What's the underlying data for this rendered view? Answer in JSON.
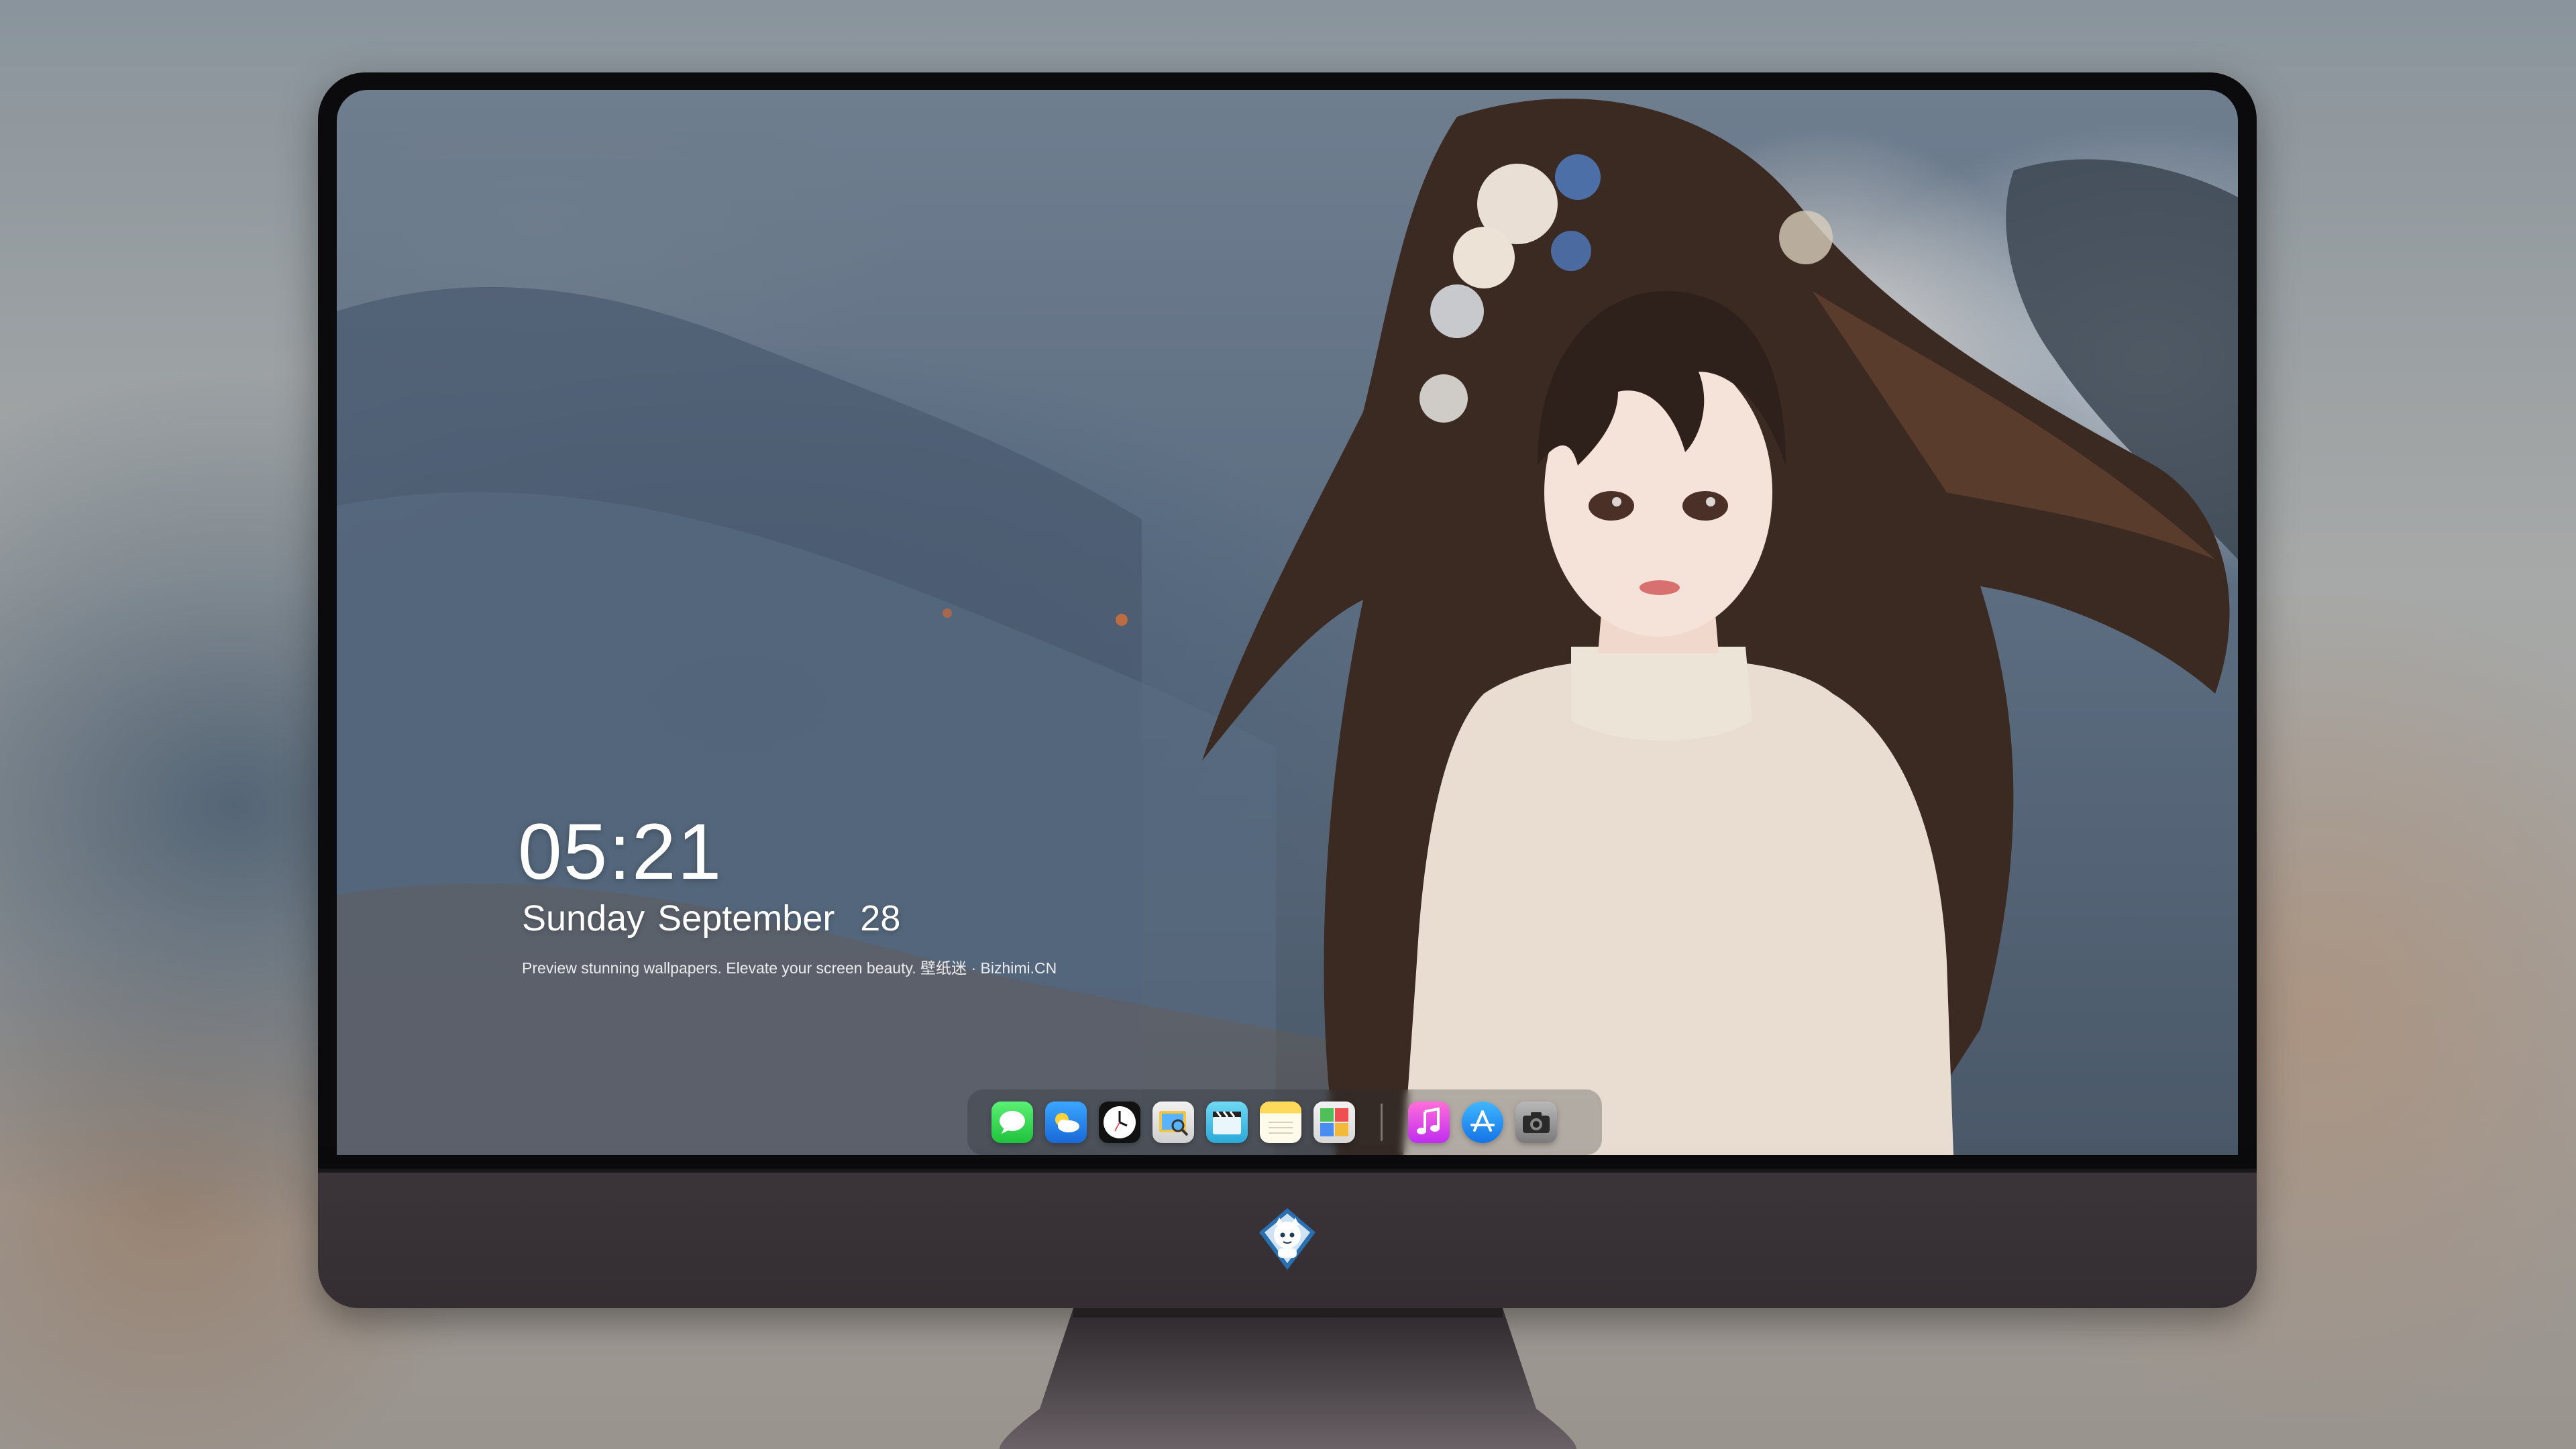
{
  "lockscreen": {
    "time": "05:21",
    "date": "Sunday September  28",
    "tagline": "Preview stunning wallpapers. Elevate your screen beauty. 壁纸迷 · Bizhimi.CN"
  },
  "dock": {
    "apps": [
      {
        "name": "messages-icon"
      },
      {
        "name": "weather-icon"
      },
      {
        "name": "clock-icon"
      },
      {
        "name": "preview-icon"
      },
      {
        "name": "clips-icon"
      },
      {
        "name": "notes-icon"
      },
      {
        "name": "photo-booth-icon"
      },
      {
        "name": "music-icon"
      },
      {
        "name": "app-store-icon"
      },
      {
        "name": "camera-icon"
      }
    ]
  },
  "colors": {
    "bezel": "#0b0b0d",
    "chin": "#3b3438",
    "clock_text": "#ffffff"
  }
}
